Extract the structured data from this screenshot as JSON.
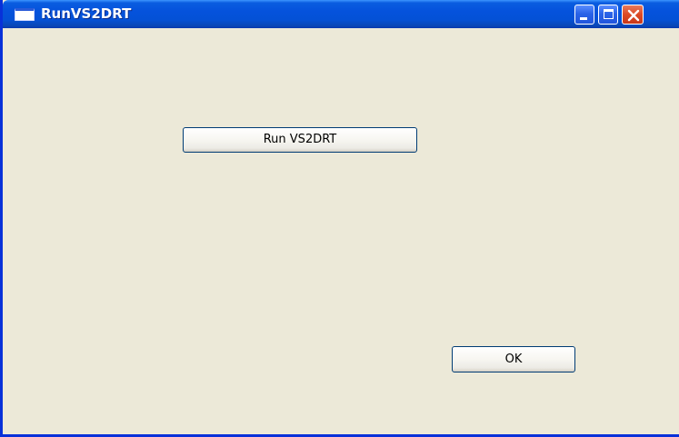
{
  "window": {
    "title": "RunVS2DRT",
    "icon": "window-icon",
    "controls": {
      "minimize_icon": "minimize-icon",
      "maximize_icon": "maximize-icon",
      "close_icon": "close-icon"
    }
  },
  "buttons": {
    "run_label": "Run VS2DRT",
    "ok_label": "OK"
  },
  "colors": {
    "titlebar": "#0552dc",
    "client_background": "#ece9d8",
    "close_button": "#dc4a25",
    "button_border": "#003c74"
  }
}
